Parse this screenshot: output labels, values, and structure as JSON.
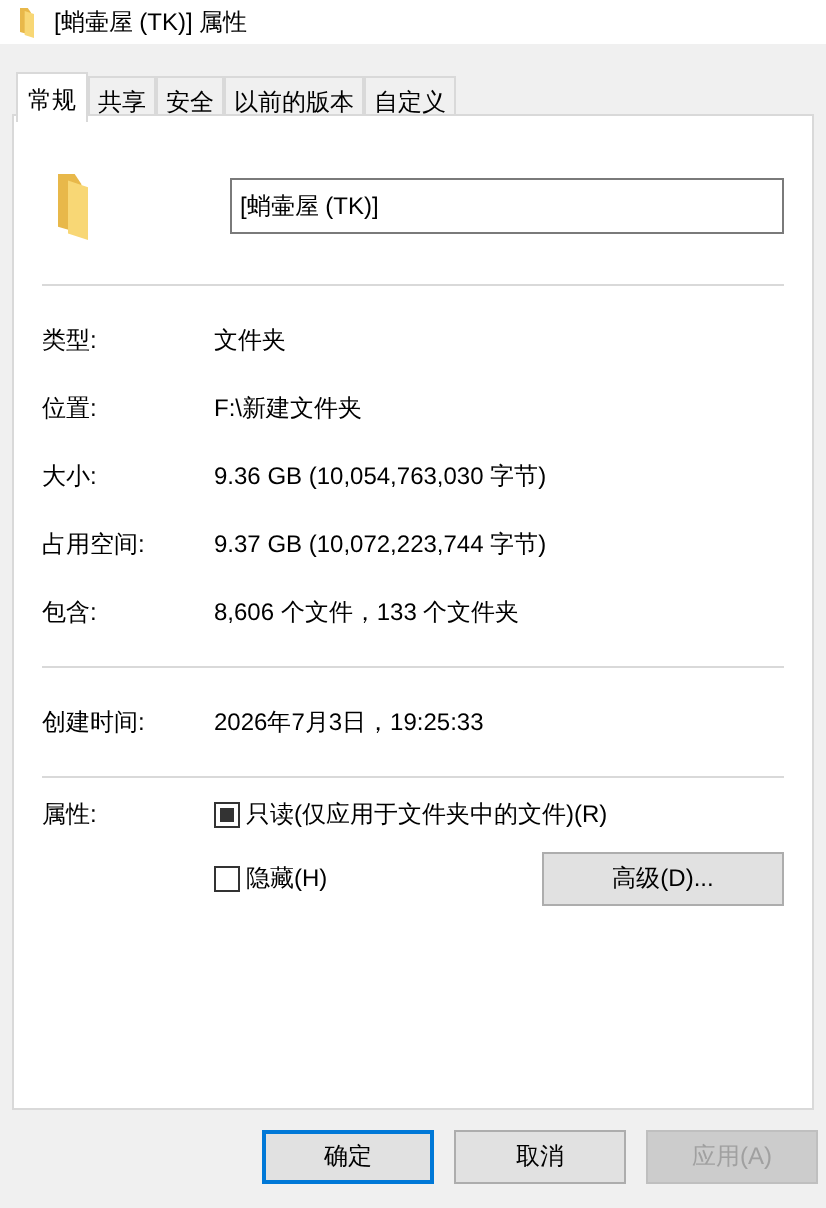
{
  "window": {
    "title": "[蛸壷屋 (TK)] 属性"
  },
  "tabs": [
    {
      "label": "常规",
      "selected": true
    },
    {
      "label": "共享",
      "selected": false
    },
    {
      "label": "安全",
      "selected": false
    },
    {
      "label": "以前的版本",
      "selected": false
    },
    {
      "label": "自定义",
      "selected": false
    }
  ],
  "name_field": {
    "value": "[蛸壷屋 (TK)]"
  },
  "groups": [
    [
      {
        "label": "类型:",
        "value": "文件夹"
      },
      {
        "label": "位置:",
        "value": "F:\\新建文件夹"
      },
      {
        "label": "大小:",
        "value": "9.36 GB (10,054,763,030 字节)"
      },
      {
        "label": "占用空间:",
        "value": "9.37 GB (10,072,223,744 字节)"
      },
      {
        "label": "包含:",
        "value": "8,606 个文件，133 个文件夹"
      }
    ],
    [
      {
        "label": "创建时间:",
        "value": "2026年7月3日，19:25:33"
      }
    ]
  ],
  "attributes": {
    "label": "属性:",
    "checkboxes": [
      {
        "label": "只读(仅应用于文件夹中的文件)(R)",
        "checked": false,
        "indeterminate": true
      },
      {
        "label": "隐藏(H)",
        "checked": false,
        "indeterminate": false
      }
    ],
    "advanced_button": "高级(D)..."
  },
  "buttons": [
    {
      "label": "确定",
      "kind": "default",
      "disabled": false
    },
    {
      "label": "取消",
      "kind": "normal",
      "disabled": false
    },
    {
      "label": "应用(A)",
      "kind": "normal",
      "disabled": true
    }
  ]
}
